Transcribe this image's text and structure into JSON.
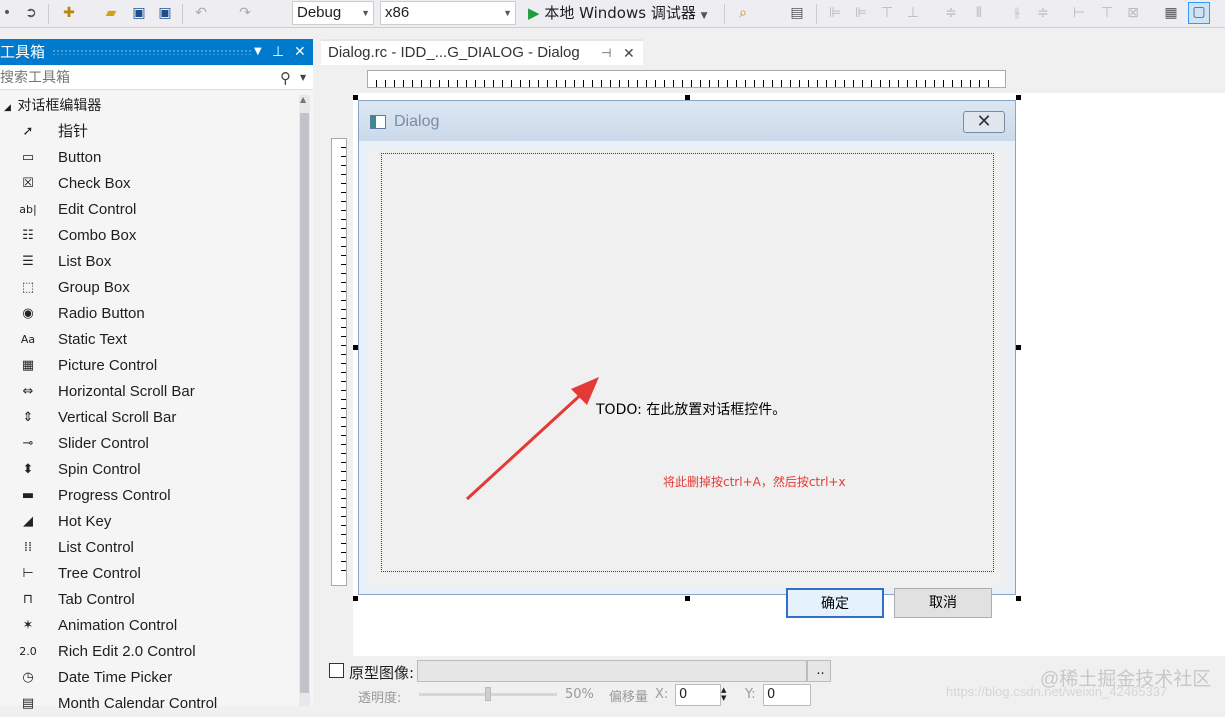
{
  "toolbar": {
    "config": "Debug",
    "platform": "x86",
    "run_label": "本地 Windows 调试器"
  },
  "toolbox": {
    "title": "工具箱",
    "search_placeholder": "搜索工具箱",
    "group": "对话框编辑器",
    "items": [
      {
        "label": "指针",
        "icon": "pointer-icon"
      },
      {
        "label": "Button",
        "icon": "button-icon"
      },
      {
        "label": "Check Box",
        "icon": "checkbox-icon"
      },
      {
        "label": "Edit Control",
        "icon": "edit-control-icon"
      },
      {
        "label": "Combo Box",
        "icon": "combobox-icon"
      },
      {
        "label": "List Box",
        "icon": "listbox-icon"
      },
      {
        "label": "Group Box",
        "icon": "groupbox-icon"
      },
      {
        "label": "Radio Button",
        "icon": "radio-icon"
      },
      {
        "label": "Static Text",
        "icon": "static-text-icon"
      },
      {
        "label": "Picture Control",
        "icon": "picture-icon"
      },
      {
        "label": "Horizontal Scroll Bar",
        "icon": "hscroll-icon"
      },
      {
        "label": "Vertical Scroll Bar",
        "icon": "vscroll-icon"
      },
      {
        "label": "Slider Control",
        "icon": "slider-icon"
      },
      {
        "label": "Spin Control",
        "icon": "spin-icon"
      },
      {
        "label": "Progress Control",
        "icon": "progress-icon"
      },
      {
        "label": "Hot Key",
        "icon": "hotkey-icon"
      },
      {
        "label": "List Control",
        "icon": "list-control-icon"
      },
      {
        "label": "Tree Control",
        "icon": "tree-icon"
      },
      {
        "label": "Tab Control",
        "icon": "tab-icon"
      },
      {
        "label": "Animation Control",
        "icon": "animation-icon"
      },
      {
        "label": "Rich Edit 2.0 Control",
        "icon": "richedit-icon"
      },
      {
        "label": "Date Time Picker",
        "icon": "datetime-icon"
      },
      {
        "label": "Month Calendar Control",
        "icon": "calendar-icon"
      }
    ]
  },
  "document": {
    "tab_label": "Dialog.rc - IDD_...G_DIALOG - Dialog"
  },
  "dialog": {
    "title": "Dialog",
    "todo_text": "TODO: 在此放置对话框控件。",
    "annotation": "将此删掉按ctrl+A，然后按ctrl+x",
    "ok_label": "确定",
    "cancel_label": "取消"
  },
  "bottom": {
    "prototype_label": "原型图像:",
    "browse_label": "..",
    "opacity_label": "透明度:",
    "opacity_value": "50%",
    "offset_label": "偏移量",
    "x_label": "X:",
    "x_value": "0",
    "y_label": "Y:",
    "y_value": "0"
  },
  "watermark": {
    "site": "@稀土掘金技术社区",
    "url": "https://blog.csdn.net/weixin_42465337"
  }
}
